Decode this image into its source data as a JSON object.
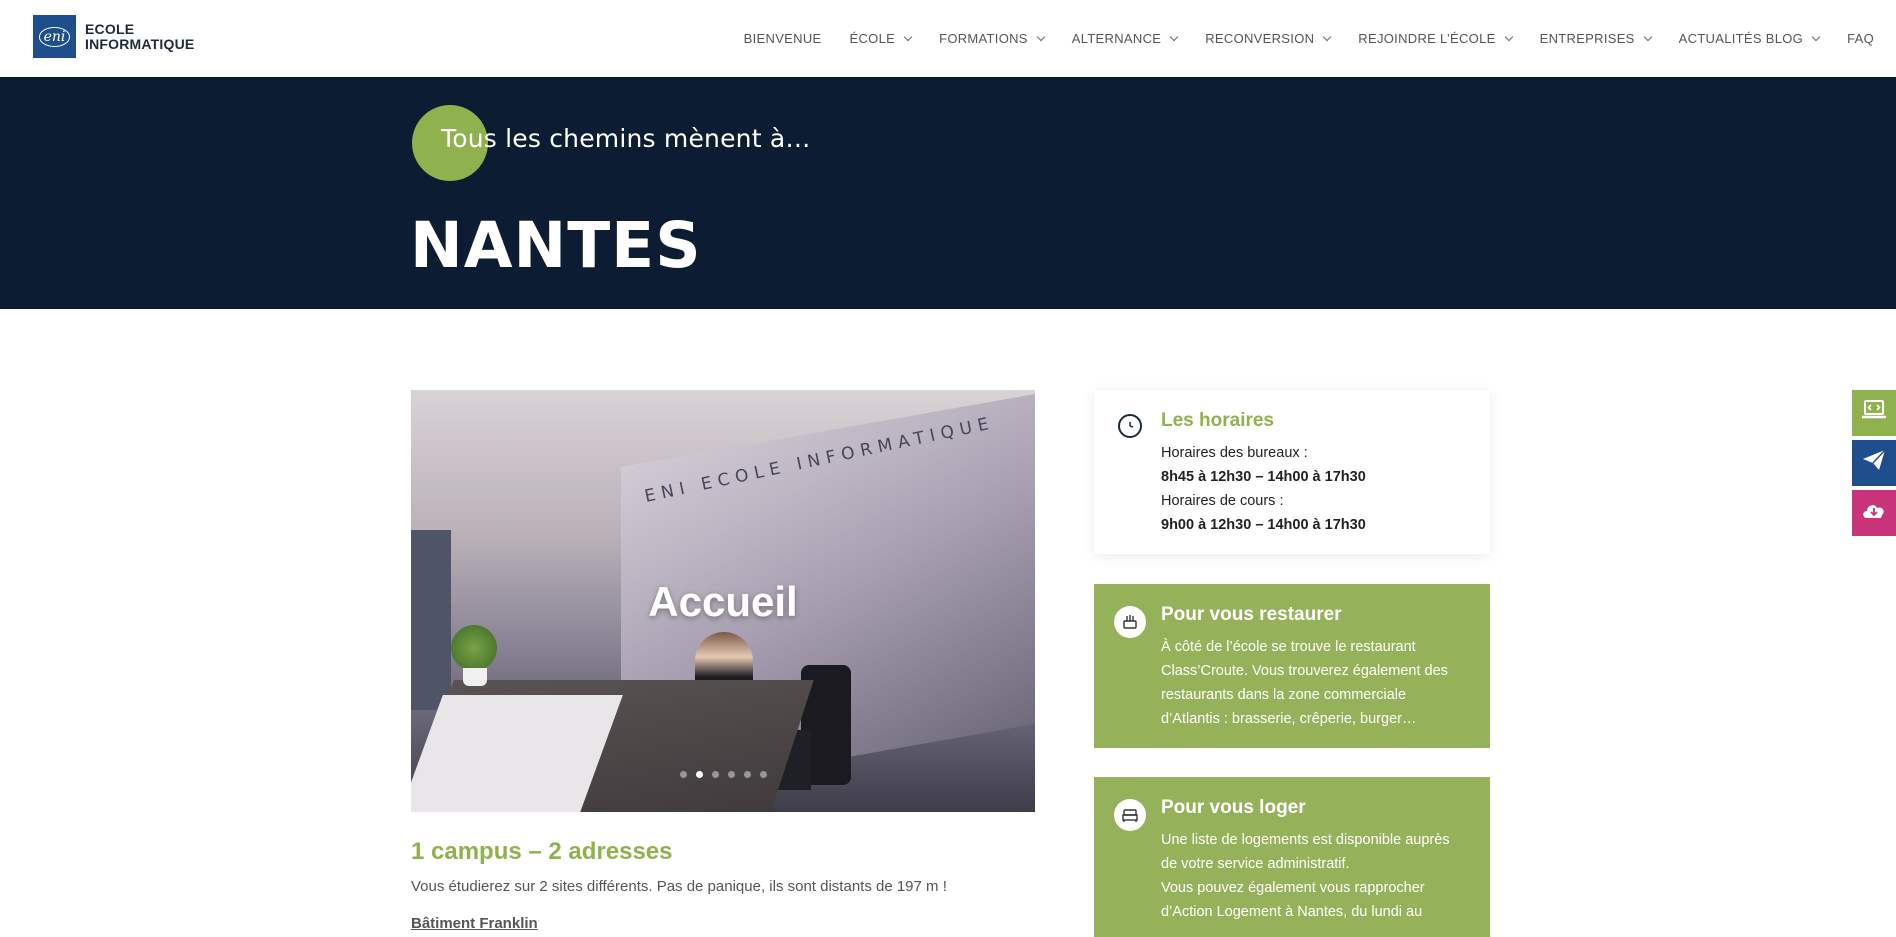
{
  "brand": {
    "logo_mark": "eni",
    "line1": "ECOLE",
    "line2": "INFORMATIQUE"
  },
  "nav": [
    {
      "label": "BIENVENUE",
      "dropdown": false
    },
    {
      "label": "ÉCOLE",
      "dropdown": true
    },
    {
      "label": "FORMATIONS",
      "dropdown": true
    },
    {
      "label": "ALTERNANCE",
      "dropdown": true
    },
    {
      "label": "RECONVERSION",
      "dropdown": true
    },
    {
      "label": "REJOINDRE L’ÉCOLE",
      "dropdown": true
    },
    {
      "label": "ENTREPRISES",
      "dropdown": true
    },
    {
      "label": "ACTUALITÉS BLOG",
      "dropdown": true
    },
    {
      "label": "FAQ",
      "dropdown": false
    }
  ],
  "hero": {
    "subtitle": "Tous les chemins mènent à…",
    "title": "NANTES"
  },
  "slider": {
    "caption": "Accueil",
    "wall_text": "ENI ECOLE INFORMATIQUE",
    "dot_count": 6,
    "active_dot": 1
  },
  "campus": {
    "title": "1 campus – 2 adresses",
    "text": "Vous étudierez sur 2 sites différents. Pas de panique, ils sont distants de 197 m !",
    "building": "Bâtiment Franklin"
  },
  "cards": {
    "hours": {
      "icon": "clock-icon",
      "title": "Les horaires",
      "l1": "Horaires des bureaux :",
      "l2": "8h45 à 12h30 – 14h00 à 17h30",
      "l3": "Horaires de cours :",
      "l4": "9h00 à 12h30 – 14h00 à 17h30"
    },
    "food": {
      "icon": "food-icon",
      "title": "Pour vous restaurer",
      "l1": "À côté de l’école se trouve le restaurant",
      "l2": "Class’Croute. Vous trouverez également des",
      "l3": "restaurants dans la zone commerciale",
      "l4": "d’Atlantis : brasserie, crêperie, burger…"
    },
    "housing": {
      "icon": "bed-icon",
      "title": "Pour vous loger",
      "l1": "Une liste de logements est disponible auprès",
      "l2": "de votre service administratif.",
      "l3": "Vous pouvez également vous rapprocher",
      "l4": "d’Action Logement à Nantes, du lundi au"
    }
  },
  "side_buttons": [
    {
      "icon": "laptop-code-icon",
      "color": "#8fb24f"
    },
    {
      "icon": "paper-plane-icon",
      "color": "#1f4e8c"
    },
    {
      "icon": "cloud-download-icon",
      "color": "#c8337a"
    }
  ],
  "colors": {
    "navy": "#0b1c33",
    "green": "#8fb24f",
    "card_green": "#95b15a",
    "blue": "#1f4e8c",
    "pink": "#c8337a"
  }
}
